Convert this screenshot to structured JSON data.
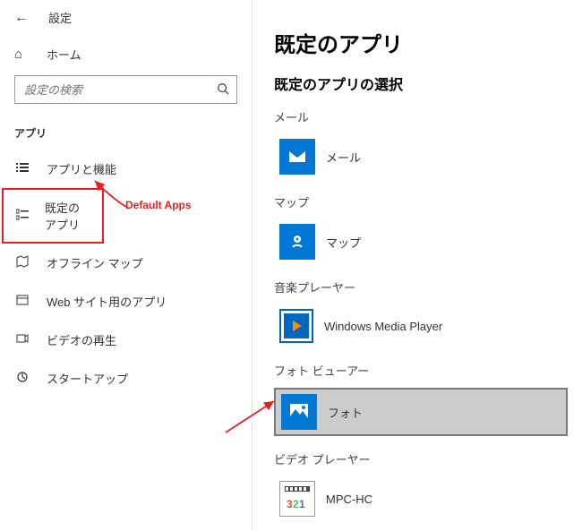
{
  "header": {
    "title": "設定"
  },
  "home": {
    "label": "ホーム"
  },
  "search": {
    "placeholder": "設定の検索"
  },
  "section": {
    "label": "アプリ"
  },
  "nav": {
    "items": [
      {
        "label": "アプリと機能"
      },
      {
        "label": "既定のアプリ"
      },
      {
        "label": "オフライン マップ"
      },
      {
        "label": "Web サイト用のアプリ"
      },
      {
        "label": "ビデオの再生"
      },
      {
        "label": "スタートアップ"
      }
    ]
  },
  "annotation": {
    "defaultApps": "Default Apps"
  },
  "page": {
    "title": "既定のアプリ",
    "subtitle": "既定のアプリの選択"
  },
  "categories": {
    "mail": {
      "label": "メール",
      "app": "メール"
    },
    "maps": {
      "label": "マップ",
      "app": "マップ"
    },
    "music": {
      "label": "音楽プレーヤー",
      "app": "Windows Media Player"
    },
    "photo": {
      "label": "フォト ビューアー",
      "app": "フォト"
    },
    "video": {
      "label": "ビデオ プレーヤー",
      "app": "MPC-HC"
    }
  },
  "colors": {
    "accent": "#0078d4",
    "highlight_border": "#e62020"
  }
}
